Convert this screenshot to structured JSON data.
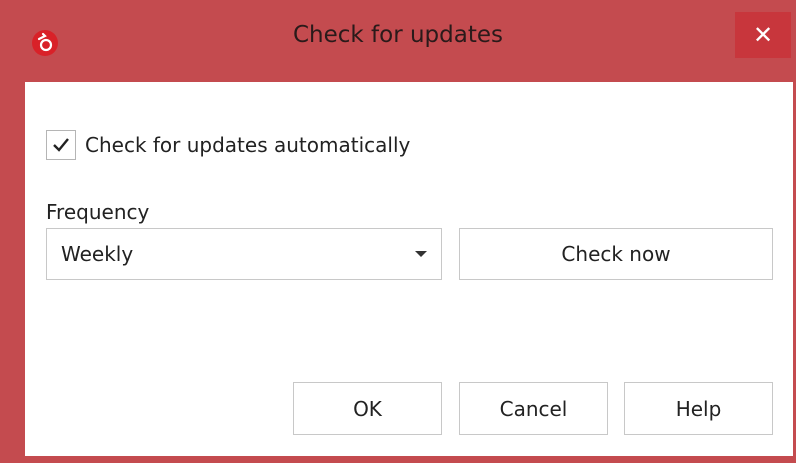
{
  "window": {
    "title": "Check for updates",
    "close_glyph": "✕",
    "accent_color": "#c44b4f",
    "app_icon": "app-logo-icon"
  },
  "settings": {
    "auto_check_label": "Check for updates automatically",
    "auto_check_checked": true,
    "frequency_label": "Frequency",
    "frequency_value": "Weekly",
    "check_now_label": "Check now"
  },
  "footer": {
    "ok_label": "OK",
    "cancel_label": "Cancel",
    "help_label": "Help"
  }
}
